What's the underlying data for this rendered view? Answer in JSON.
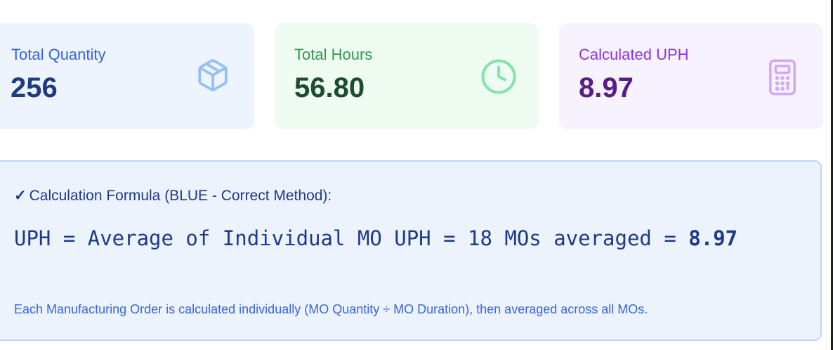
{
  "stats": {
    "total_quantity": {
      "label": "Total Quantity",
      "value": "256",
      "icon": "cube-icon",
      "accent": "#3563e0"
    },
    "total_hours": {
      "label": "Total Hours",
      "value": "56.80",
      "icon": "clock-icon",
      "accent": "#2f9a4e"
    },
    "calculated_uph": {
      "label": "Calculated UPH",
      "value": "8.97",
      "icon": "calculator-icon",
      "accent": "#8f34dc"
    }
  },
  "formula": {
    "check_mark": "✓",
    "title": "Calculation Formula (BLUE - Correct Method):",
    "expression": "UPH = Average of Individual MO UPH = 18 MOs averaged = ",
    "result": "8.97",
    "note": "Each Manufacturing Order is calculated individually (MO Quantity ÷ MO Duration), then averaged across all MOs."
  }
}
